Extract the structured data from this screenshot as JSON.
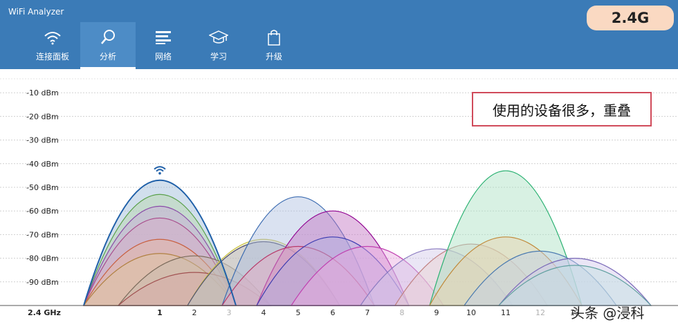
{
  "app": {
    "title": "WiFi Analyzer",
    "band_badge": "2.4G"
  },
  "tabs": [
    {
      "label": "连接面板",
      "icon": "wifi-icon",
      "active": false
    },
    {
      "label": "分析",
      "icon": "search-icon",
      "active": true
    },
    {
      "label": "网络",
      "icon": "list-icon",
      "active": false
    },
    {
      "label": "学习",
      "icon": "graduation-cap-icon",
      "active": false
    },
    {
      "label": "升级",
      "icon": "shopping-bag-icon",
      "active": false
    }
  ],
  "annotation": "使用的设备很多，重叠",
  "watermark": "头条 @浸科",
  "chart_data": {
    "type": "area",
    "xlabel": "2.4 GHz",
    "x_ticks": [
      "1",
      "2",
      "3",
      "4",
      "5",
      "6",
      "7",
      "8",
      "9",
      "10",
      "11",
      "12",
      "13"
    ],
    "y_ticks": [
      "-10 dBm",
      "-20 dBm",
      "-30 dBm",
      "-40 dBm",
      "-50 dBm",
      "-60 dBm",
      "-70 dBm",
      "-80 dBm",
      "-90 dBm"
    ],
    "ylim": [
      -100,
      0
    ],
    "grid": true,
    "connected_channel": 1,
    "series": [
      {
        "center": 1,
        "peak": -47,
        "color": "#1e5fa8",
        "fill": "#9ab8d8"
      },
      {
        "center": 1,
        "peak": -53,
        "color": "#5aa04a",
        "fill": "#b5d8a8"
      },
      {
        "center": 1,
        "peak": -58,
        "color": "#8a4aa8",
        "fill": "#c8a8d8"
      },
      {
        "center": 1,
        "peak": -63,
        "color": "#a84a8a",
        "fill": "#d8a8c8"
      },
      {
        "center": 1,
        "peak": -72,
        "color": "#c86040",
        "fill": "#e8b8a0"
      },
      {
        "center": 1,
        "peak": -78,
        "color": "#b08040",
        "fill": "#e0c8a0"
      },
      {
        "center": 2,
        "peak": -79,
        "color": "#7a6a5a",
        "fill": "#c8bcb0"
      },
      {
        "center": 2,
        "peak": -86,
        "color": "#a05050",
        "fill": "#d8a8a8"
      },
      {
        "center": 4,
        "peak": -72,
        "color": "#c8c040",
        "fill": "#eee8b0"
      },
      {
        "center": 4,
        "peak": -73,
        "color": "#505070",
        "fill": "#a8a8c0"
      },
      {
        "center": 5,
        "peak": -54,
        "color": "#3a6ab0",
        "fill": "#aebfe0"
      },
      {
        "center": 6,
        "peak": -60,
        "color": "#900090",
        "fill": "#c070c0"
      },
      {
        "center": 5,
        "peak": -75,
        "color": "#b83a6a",
        "fill": "#e8a8c0"
      },
      {
        "center": 6,
        "peak": -71,
        "color": "#3a3ab0",
        "fill": "#b0b0e0"
      },
      {
        "center": 7,
        "peak": -75,
        "color": "#c040b0",
        "fill": "#e8a8e0"
      },
      {
        "center": 9,
        "peak": -76,
        "color": "#8a7ac0",
        "fill": "#d0c8e8"
      },
      {
        "center": 10,
        "peak": -74,
        "color": "#c08080",
        "fill": "#ecd0d0"
      },
      {
        "center": 11,
        "peak": -43,
        "color": "#28b070",
        "fill": "#a8e0c0"
      },
      {
        "center": 11,
        "peak": -71,
        "color": "#c08838",
        "fill": "#ecd0a8"
      },
      {
        "center": 12,
        "peak": -77,
        "color": "#4a7ab0",
        "fill": "#c0d0e8"
      },
      {
        "center": 13,
        "peak": -80,
        "color": "#7a6ab8",
        "fill": "#d0c8ec"
      },
      {
        "center": 13,
        "peak": -83,
        "color": "#60a0a0",
        "fill": "#c0e0e0"
      }
    ]
  }
}
